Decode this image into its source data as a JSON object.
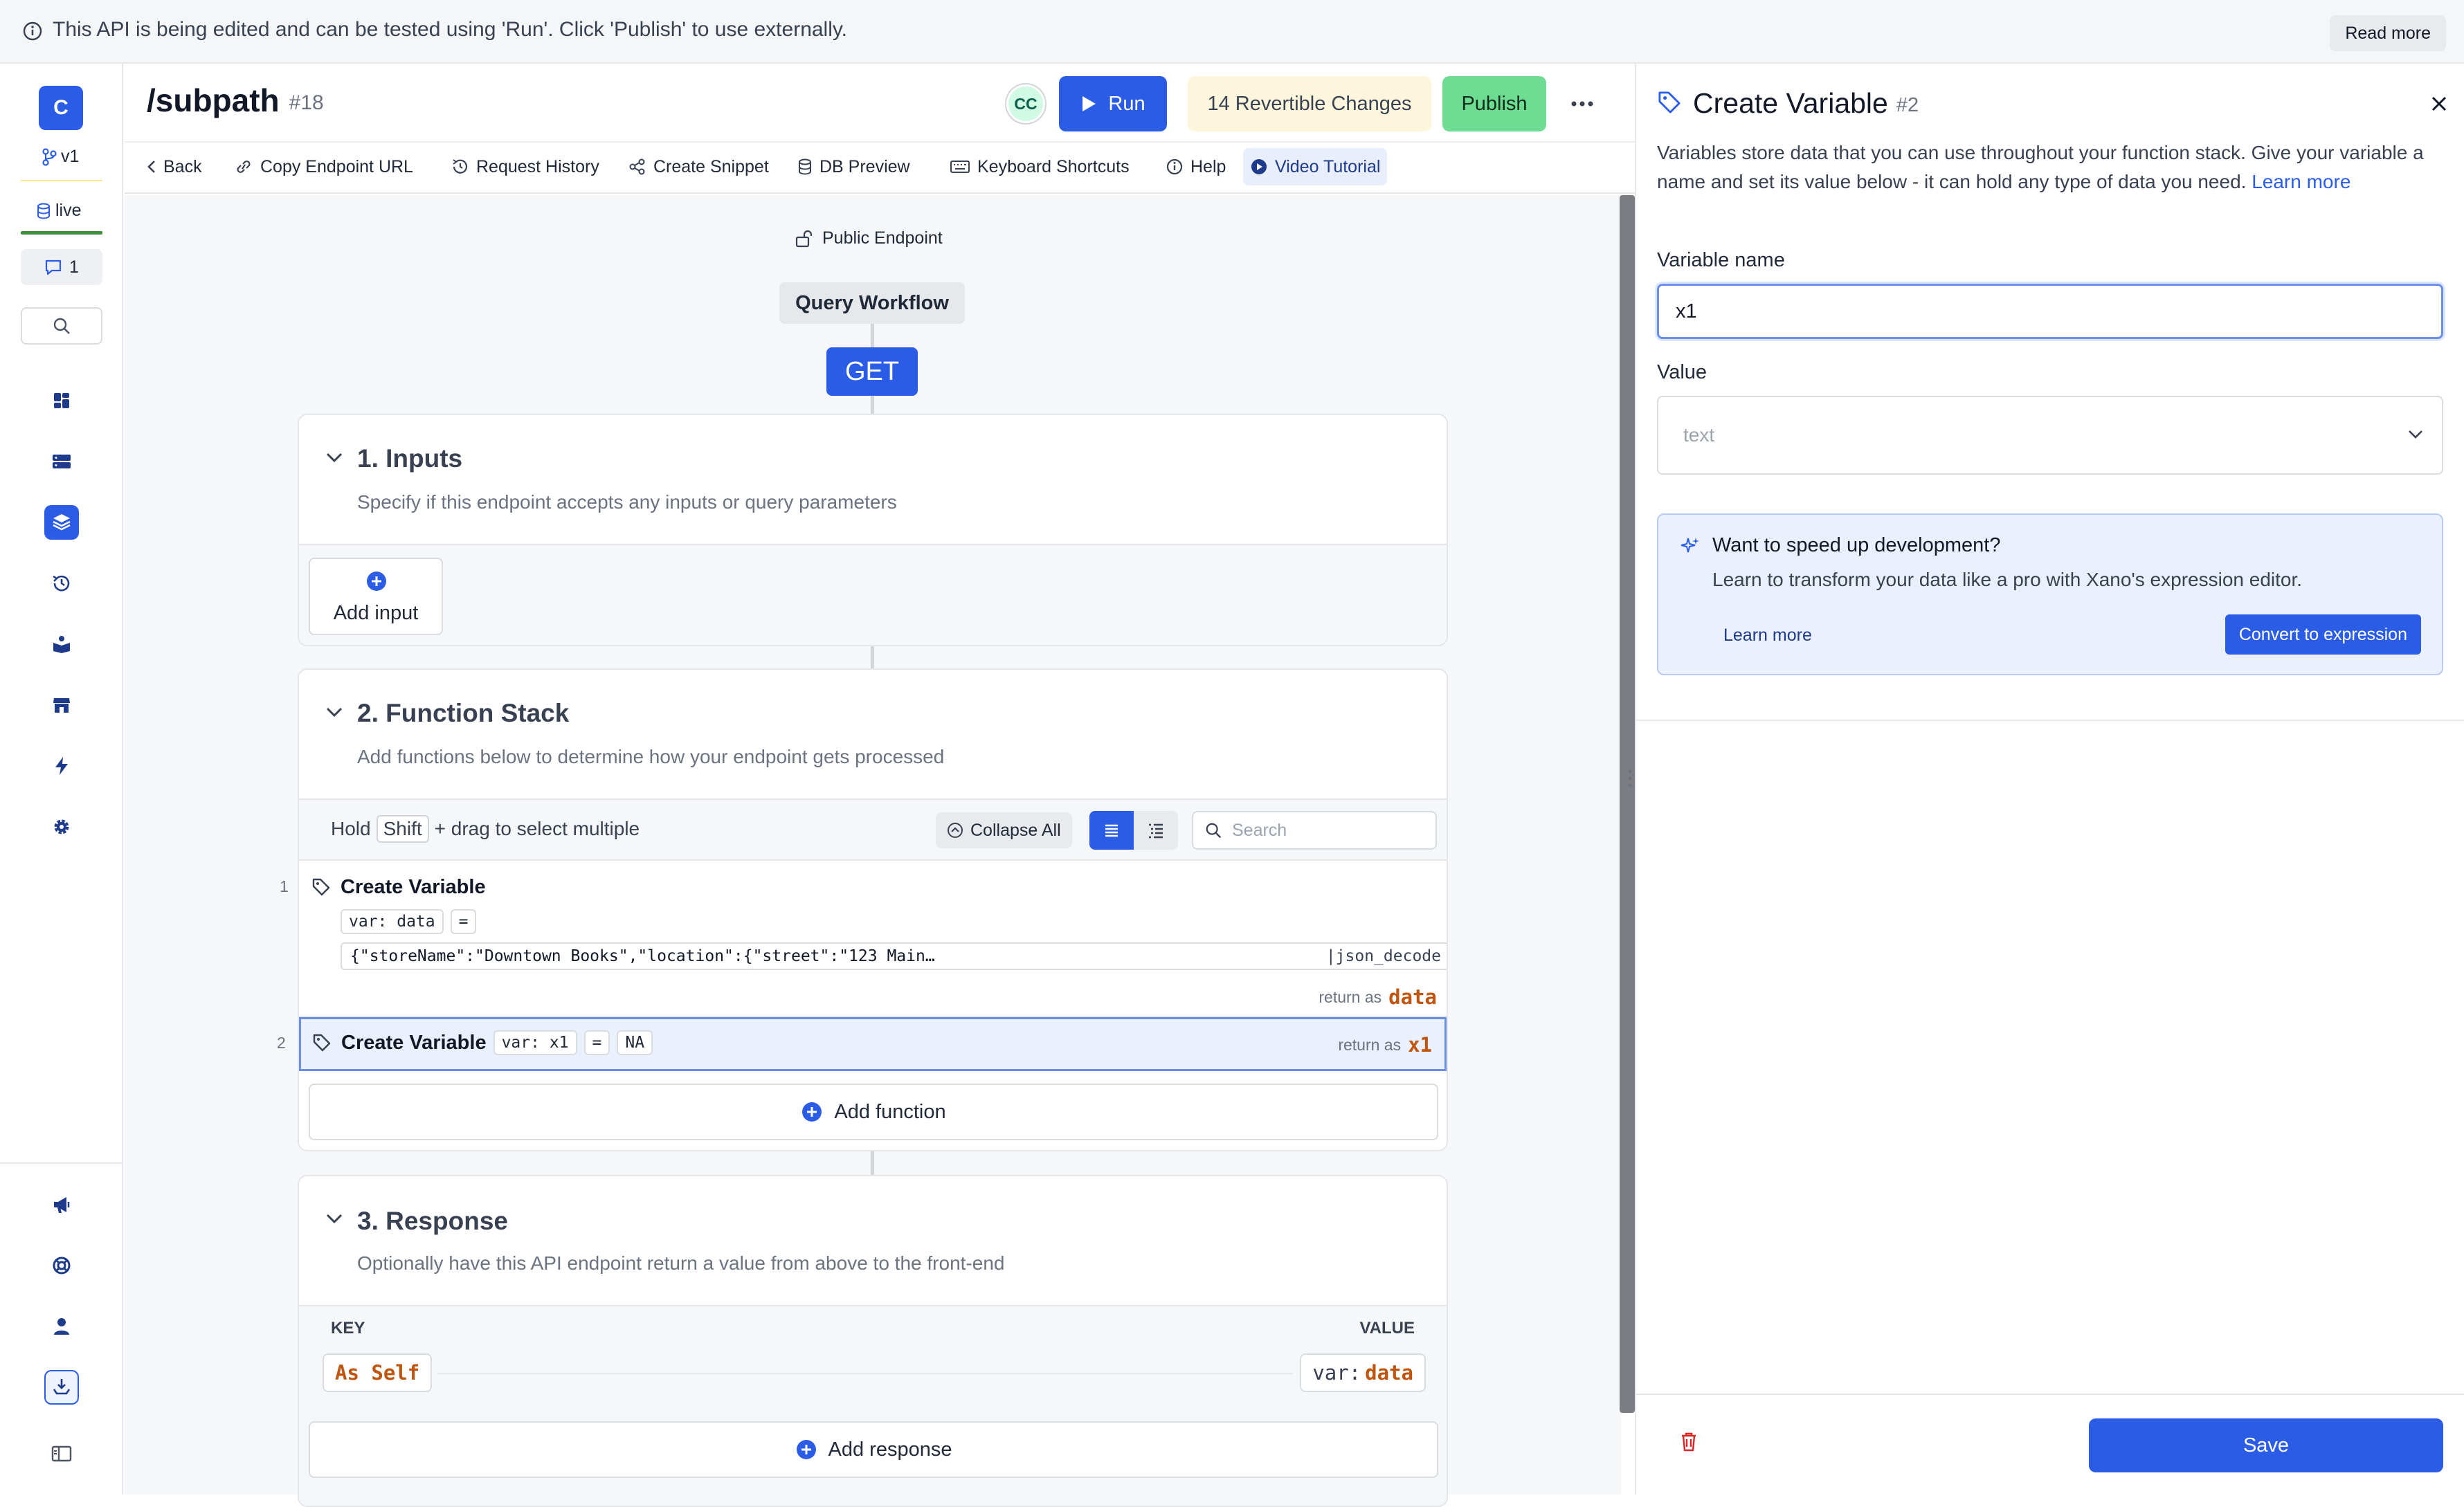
{
  "banner": {
    "text": "This API is being edited and can be tested using 'Run'. Click 'Publish' to use externally.",
    "read_more": "Read more"
  },
  "rail": {
    "workspace_letter": "C",
    "branch": "v1",
    "env": "live",
    "comments_count": "1"
  },
  "header": {
    "title": "/subpath",
    "id": "#18",
    "avatar": "CC",
    "run_label": "Run",
    "changes_label": "14 Revertible Changes",
    "publish_label": "Publish"
  },
  "toolbar": {
    "back": "Back",
    "copy_url": "Copy Endpoint URL",
    "request_history": "Request History",
    "create_snippet": "Create Snippet",
    "db_preview": "DB Preview",
    "keyboard_shortcuts": "Keyboard Shortcuts",
    "help": "Help",
    "video_tutorial": "Video Tutorial"
  },
  "workflow": {
    "public_endpoint": "Public Endpoint",
    "query_workflow": "Query Workflow",
    "method": "GET"
  },
  "inputs": {
    "title": "1. Inputs",
    "subtitle": "Specify if this endpoint accepts any inputs or query parameters",
    "add_input": "Add input"
  },
  "function_stack": {
    "title": "2. Function Stack",
    "subtitle": "Add functions below to determine how your endpoint gets processed",
    "hold": "Hold",
    "shift": "Shift",
    "drag_text": "+ drag to select multiple",
    "collapse_all": "Collapse All",
    "search_placeholder": "Search",
    "add_function": "Add function",
    "items": [
      {
        "num": "1",
        "name": "Create Variable",
        "var_chip": "var: data",
        "eq": "=",
        "value": "{\"storeName\":\"Downtown Books\",\"location\":{\"street\":\"123 Main…",
        "filter": "|json_decode",
        "return_as": "return as",
        "return_var": "data"
      },
      {
        "num": "2",
        "name": "Create Variable",
        "var_chip": "var: x1",
        "eq": "=",
        "value": "NA",
        "return_as": "return as",
        "return_var": "x1"
      }
    ]
  },
  "response": {
    "title": "3. Response",
    "subtitle": "Optionally have this API endpoint return a value from above to the front-end",
    "key_header": "KEY",
    "value_header": "VALUE",
    "key": "As Self",
    "value_prefix": "var:",
    "value_var": "data",
    "add_response": "Add response"
  },
  "panel": {
    "title": "Create Variable",
    "id": "#2",
    "description": "Variables store data that you can use throughout your function stack. Give your variable a name and set its value below - it can hold any type of data you need.",
    "learn_more_inline": "Learn more",
    "name_label": "Variable name",
    "name_value": "x1",
    "value_label": "Value",
    "value_placeholder": "text",
    "tip_title": "Want to speed up development?",
    "tip_text": "Learn to transform your data like a pro with Xano's expression editor.",
    "tip_learn_more": "Learn more",
    "convert_label": "Convert to expression",
    "save_label": "Save"
  },
  "colors": {
    "accent": "#2b5ce6",
    "publish": "#6fdc94",
    "changes_bg": "#fdf6dd",
    "return_var": "#c0550f",
    "live": "#3f8f3f"
  }
}
